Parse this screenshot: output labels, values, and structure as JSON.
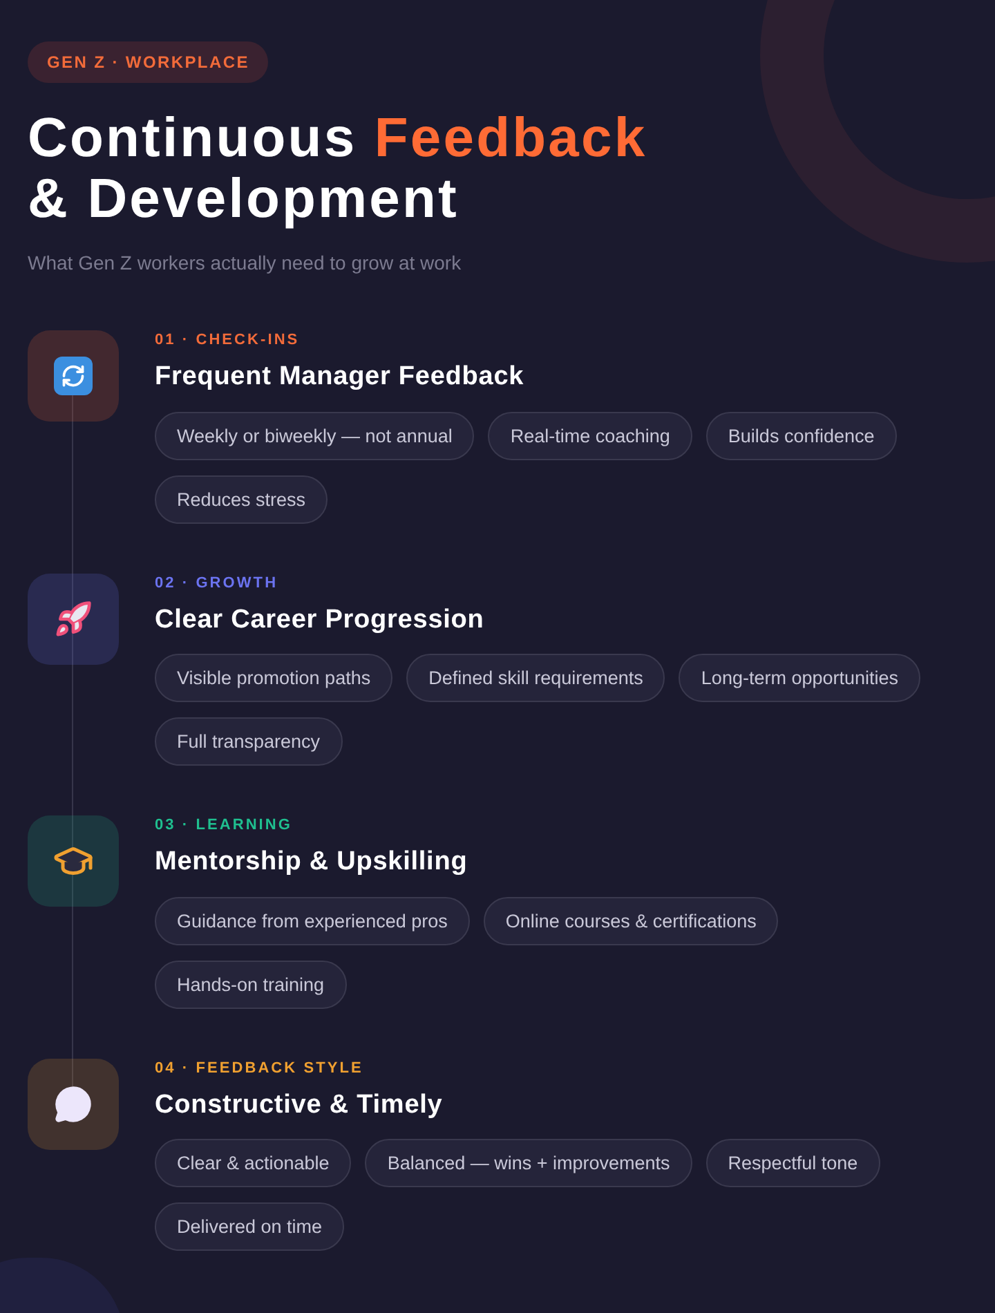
{
  "badge": "GEN Z · WORKPLACE",
  "title": {
    "line1_plain": "Continuous",
    "line1_accent": "Feedback",
    "line2": "& Development"
  },
  "subtitle": "What Gen Z workers actually need to grow at work",
  "sections": [
    {
      "kind": "refresh",
      "color": "#f26b3a",
      "label": "01 · CHECK-INS",
      "heading": "Frequent Manager Feedback",
      "chips": [
        "Weekly or biweekly — not annual",
        "Real-time coaching",
        "Builds confidence",
        "Reduces stress"
      ]
    },
    {
      "kind": "rocket",
      "color": "#6b73f0",
      "label": "02 · GROWTH",
      "heading": "Clear Career Progression",
      "chips": [
        "Visible promotion paths",
        "Defined skill requirements",
        "Long-term opportunities",
        "Full transparency"
      ]
    },
    {
      "kind": "cap",
      "color": "#1fbf8f",
      "label": "03 · LEARNING",
      "heading": "Mentorship & Upskilling",
      "chips": [
        "Guidance from experienced pros",
        "Online courses & certifications",
        "Hands-on training"
      ]
    },
    {
      "kind": "speech",
      "color": "#f0a030",
      "label": "04 · FEEDBACK STYLE",
      "heading": "Constructive & Timely",
      "chips": [
        "Clear & actionable",
        "Balanced — wins + improvements",
        "Respectful tone",
        "Delivered on time"
      ]
    }
  ]
}
